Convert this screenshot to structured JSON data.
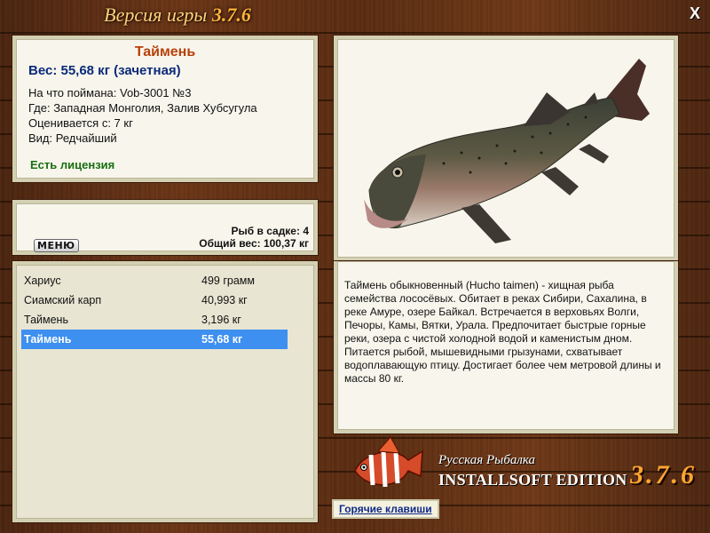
{
  "window": {
    "title_prefix": "Версия игры",
    "title_version": "3.7.6",
    "close_label": "X"
  },
  "fish_info": {
    "name": "Таймень",
    "weight_line": "Вес: 55,68 кг (зачетная)",
    "caught_with": "На что поймана: Vob-3001 №3",
    "location": "Где: Западная Монголия, Залив Хубсугула",
    "valued_from": "Оценивается с: 7 кг",
    "rarity": "Вид: Редчайший",
    "license": "Есть лицензия"
  },
  "cage": {
    "menu_label": "МЕНЮ",
    "count_text": "Рыб в садке: 4",
    "total_text": "Общий вес: 100,37 кг"
  },
  "catch_list": [
    {
      "name": "Хариус",
      "weight": "499 грамм"
    },
    {
      "name": "Сиамский карп",
      "weight": "40,993 кг"
    },
    {
      "name": "Таймень",
      "weight": "3,196 кг"
    },
    {
      "name": "Таймень",
      "weight": "55,68 кг"
    }
  ],
  "description": "Таймень обыкновенный (Hucho taimen) - хищная рыба семейства лососёвых. Обитает в реках Сибири, Сахалина, в реке Амуре, озере Байкал. Встречается в верховьях Волги, Печоры, Камы, Вятки, Урала. Предпочитает быстрые горные реки, озера с чистой холодной водой и каменистым дном. Питается рыбой, мышевидными грызунами, схватывает водоплавающую птицу. Достигает более чем метровой длины и массы 80 кг.",
  "branding": {
    "subtitle": "Русская Рыбалка",
    "edition": "INSTALLSOFT EDITION",
    "version": "3.7.6"
  },
  "hotkeys_label": "Горячие клавиши",
  "colors": {
    "accent_name": "#b8400a",
    "weight_blue": "#0a2a7a",
    "license_green": "#176e12",
    "selection": "#3d8ff0"
  }
}
